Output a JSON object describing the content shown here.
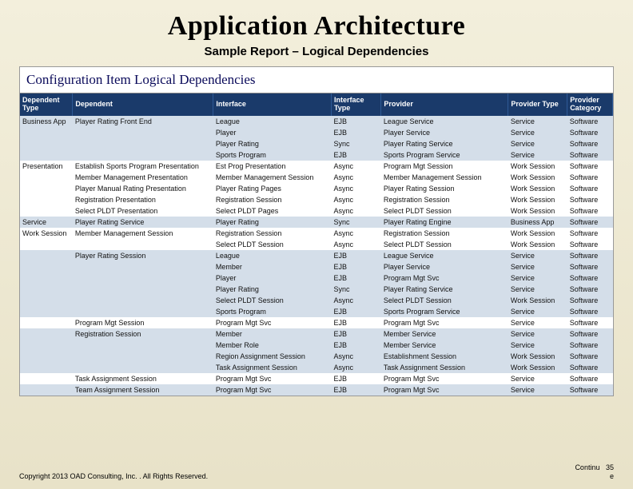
{
  "heading": "Application Architecture",
  "subtitle": "Sample Report – Logical Dependencies",
  "report_title": "Configuration Item Logical Dependencies",
  "columns": [
    "Dependent Type",
    "Dependent",
    "Interface",
    "Interface Type",
    "Provider",
    "Provider Type",
    "Provider Category"
  ],
  "rows": [
    {
      "alt": true,
      "c": [
        "Business App",
        "Player Rating Front End",
        "League",
        "EJB",
        "League Service",
        "Service",
        "Software"
      ]
    },
    {
      "alt": true,
      "c": [
        "",
        "",
        "Player",
        "EJB",
        "Player Service",
        "Service",
        "Software"
      ]
    },
    {
      "alt": true,
      "c": [
        "",
        "",
        "Player Rating",
        "Sync",
        "Player Rating Service",
        "Service",
        "Software"
      ]
    },
    {
      "alt": true,
      "c": [
        "",
        "",
        "Sports Program",
        "EJB",
        "Sports Program Service",
        "Service",
        "Software"
      ]
    },
    {
      "alt": false,
      "c": [
        "Presentation",
        "Establish Sports Program Presentation",
        "Est Prog Presentation",
        "Async",
        "Program Mgt Session",
        "Work Session",
        "Software"
      ]
    },
    {
      "alt": false,
      "c": [
        "",
        "Member Management Presentation",
        "Member Management Session",
        "Async",
        "Member Management Session",
        "Work Session",
        "Software"
      ]
    },
    {
      "alt": false,
      "c": [
        "",
        "Player Manual Rating Presentation",
        "Player Rating Pages",
        "Async",
        "Player Rating Session",
        "Work Session",
        "Software"
      ]
    },
    {
      "alt": false,
      "c": [
        "",
        "Registration Presentation",
        "Registration Session",
        "Async",
        "Registration Session",
        "Work Session",
        "Software"
      ]
    },
    {
      "alt": false,
      "c": [
        "",
        "Select PLDT Presentation",
        "Select PLDT Pages",
        "Async",
        "Select PLDT Session",
        "Work Session",
        "Software"
      ]
    },
    {
      "alt": true,
      "c": [
        "Service",
        "Player Rating Service",
        "Player Rating",
        "Sync",
        "Player Rating Engine",
        "Business App",
        "Software"
      ]
    },
    {
      "alt": false,
      "c": [
        "Work Session",
        "Member Management Session",
        "Registration Session",
        "Async",
        "Registration Session",
        "Work Session",
        "Software"
      ]
    },
    {
      "alt": false,
      "c": [
        "",
        "",
        "Select PLDT Session",
        "Async",
        "Select PLDT Session",
        "Work Session",
        "Software"
      ]
    },
    {
      "alt": true,
      "c": [
        "",
        "Player Rating Session",
        "League",
        "EJB",
        "League Service",
        "Service",
        "Software"
      ]
    },
    {
      "alt": true,
      "c": [
        "",
        "",
        "Member",
        "EJB",
        "Player Service",
        "Service",
        "Software"
      ]
    },
    {
      "alt": true,
      "c": [
        "",
        "",
        "Player",
        "EJB",
        "Program Mgt Svc",
        "Service",
        "Software"
      ]
    },
    {
      "alt": true,
      "c": [
        "",
        "",
        "Player Rating",
        "Sync",
        "Player Rating Service",
        "Service",
        "Software"
      ]
    },
    {
      "alt": true,
      "c": [
        "",
        "",
        "Select PLDT Session",
        "Async",
        "Select PLDT Session",
        "Work Session",
        "Software"
      ]
    },
    {
      "alt": true,
      "c": [
        "",
        "",
        "Sports Program",
        "EJB",
        "Sports Program Service",
        "Service",
        "Software"
      ]
    },
    {
      "alt": false,
      "c": [
        "",
        "Program Mgt Session",
        "Program Mgt Svc",
        "EJB",
        "Program Mgt Svc",
        "Service",
        "Software"
      ]
    },
    {
      "alt": true,
      "c": [
        "",
        "Registration Session",
        "Member",
        "EJB",
        "Member Service",
        "Service",
        "Software"
      ]
    },
    {
      "alt": true,
      "c": [
        "",
        "",
        "Member Role",
        "EJB",
        "Member Service",
        "Service",
        "Software"
      ]
    },
    {
      "alt": true,
      "c": [
        "",
        "",
        "Region Assignment Session",
        "Async",
        "Establishment Session",
        "Work Session",
        "Software"
      ]
    },
    {
      "alt": true,
      "c": [
        "",
        "",
        "Task Assignment Session",
        "Async",
        "Task Assignment Session",
        "Work Session",
        "Software"
      ]
    },
    {
      "alt": false,
      "c": [
        "",
        "Task Assignment Session",
        "Program Mgt Svc",
        "EJB",
        "Program Mgt Svc",
        "Service",
        "Software"
      ]
    },
    {
      "alt": true,
      "c": [
        "",
        "Team Assignment Session",
        "Program Mgt Svc",
        "EJB",
        "Program Mgt Svc",
        "Service",
        "Software"
      ]
    }
  ],
  "footer_left": "Copyright 2013 OAD Consulting, Inc. . All Rights Reserved.",
  "footer_right_label": "Continu",
  "footer_right_sub": "e",
  "slide_number": "35"
}
